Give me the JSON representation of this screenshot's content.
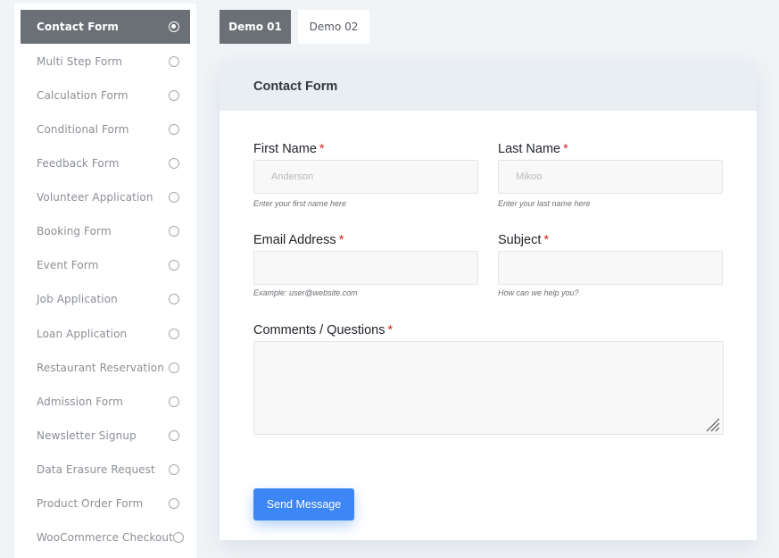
{
  "sidebar": {
    "items": [
      {
        "label": "Contact Form",
        "active": true
      },
      {
        "label": "Multi Step Form"
      },
      {
        "label": "Calculation Form"
      },
      {
        "label": "Conditional Form"
      },
      {
        "label": "Feedback Form"
      },
      {
        "label": "Volunteer Application"
      },
      {
        "label": "Booking Form"
      },
      {
        "label": "Event Form"
      },
      {
        "label": "Job Application"
      },
      {
        "label": "Loan Application"
      },
      {
        "label": "Restaurant Reservation"
      },
      {
        "label": "Admission Form"
      },
      {
        "label": "Newsletter Signup"
      },
      {
        "label": "Data Erasure Request"
      },
      {
        "label": "Product Order Form"
      },
      {
        "label": "WooCommerce Checkout"
      }
    ]
  },
  "tabs": [
    {
      "label": "Demo 01",
      "active": true
    },
    {
      "label": "Demo 02"
    }
  ],
  "form": {
    "title": "Contact Form",
    "required_mark": "*",
    "first_name": {
      "label": "First Name",
      "placeholder": "Anderson",
      "hint": "Enter your first name here"
    },
    "last_name": {
      "label": "Last Name",
      "placeholder": "Mikoo",
      "hint": "Enter your last name here"
    },
    "email": {
      "label": "Email Address",
      "placeholder": "",
      "hint": "Example: user@website.com"
    },
    "subject": {
      "label": "Subject",
      "placeholder": "",
      "hint": "How can we help you?"
    },
    "comments": {
      "label": "Comments / Questions",
      "placeholder": ""
    },
    "submit_label": "Send Message"
  },
  "colors": {
    "active_bg": "#6b6f76",
    "accent": "#3d86f5",
    "required": "#d0281c",
    "header_bg": "#e9eef2",
    "page_bg": "#f1f4f7"
  }
}
